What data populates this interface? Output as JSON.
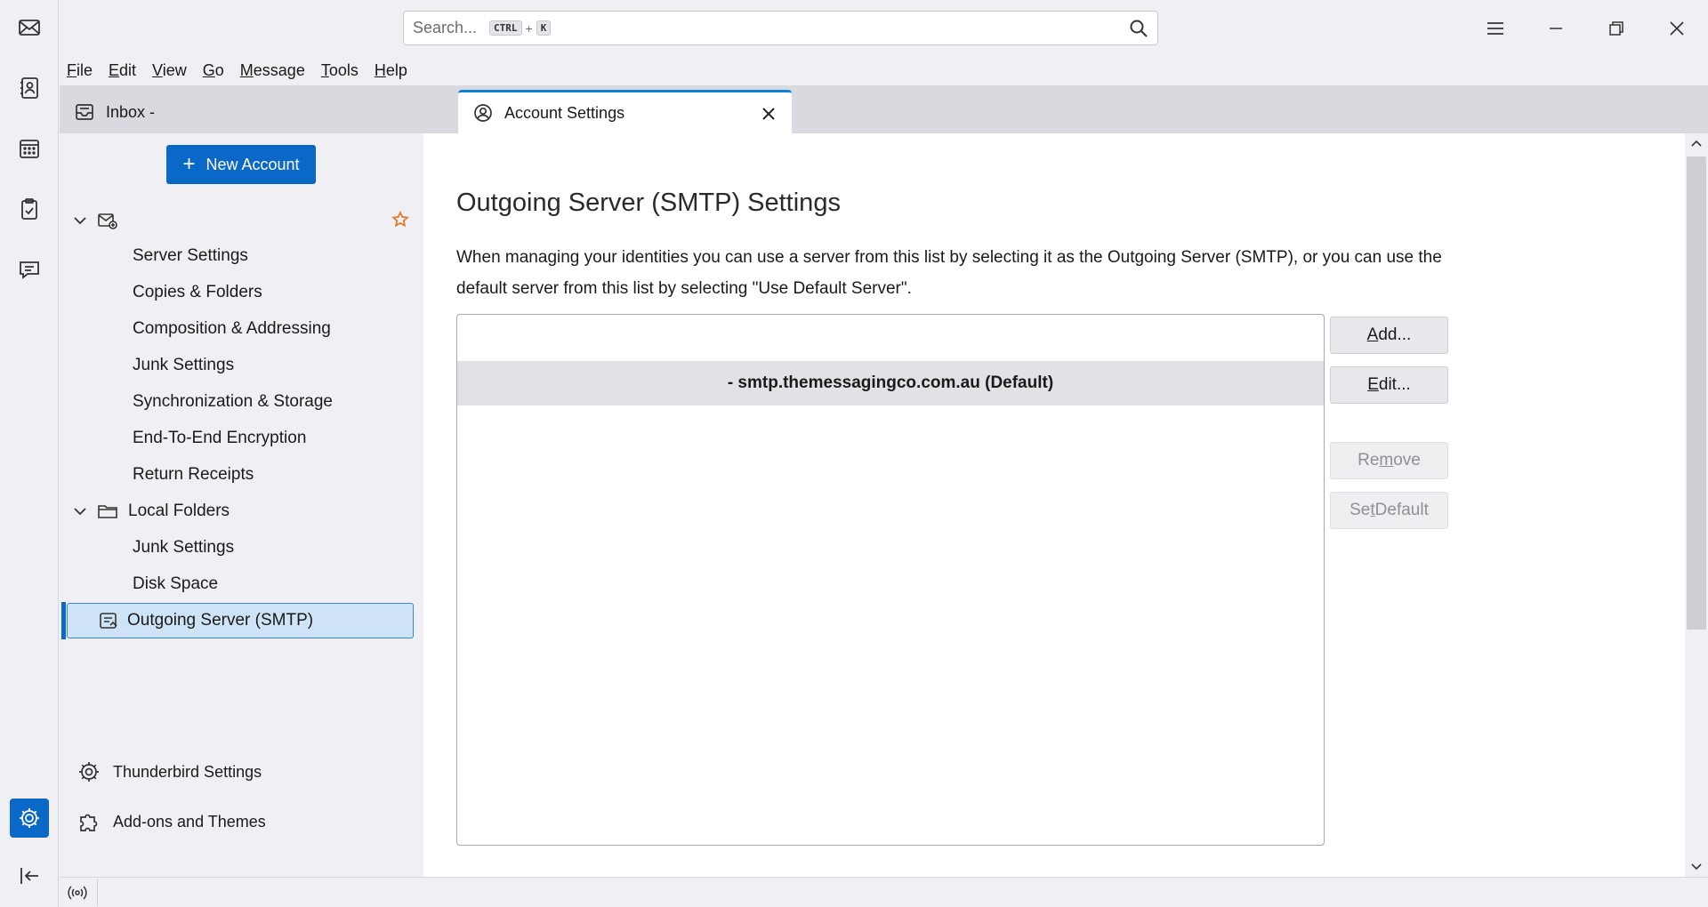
{
  "search": {
    "placeholder": "Search...",
    "key1": "CTRL",
    "plus": "+",
    "key2": "K"
  },
  "menu": [
    {
      "label": "File",
      "ul": "F",
      "rest": "ile"
    },
    {
      "label": "Edit",
      "ul": "E",
      "rest": "dit"
    },
    {
      "label": "View",
      "ul": "V",
      "rest": "iew"
    },
    {
      "label": "Go",
      "ul": "G",
      "rest": "o"
    },
    {
      "label": "Message",
      "ul": "M",
      "rest": "essage"
    },
    {
      "label": "Tools",
      "ul": "T",
      "rest": "ools"
    },
    {
      "label": "Help",
      "ul": "H",
      "rest": "elp"
    }
  ],
  "tabs": {
    "inbox": "Inbox -",
    "settings": "Account Settings"
  },
  "sidebar": {
    "new_account": "New Account",
    "account1_items": [
      "Server Settings",
      "Copies & Folders",
      "Composition & Addressing",
      "Junk Settings",
      "Synchronization & Storage",
      "End-To-End Encryption",
      "Return Receipts"
    ],
    "local_folders": "Local Folders",
    "local_items": [
      "Junk Settings",
      "Disk Space"
    ],
    "outgoing": "Outgoing Server (SMTP)",
    "thunderbird_settings": "Thunderbird Settings",
    "addons": "Add-ons and Themes"
  },
  "main": {
    "title": "Outgoing Server (SMTP) Settings",
    "description": "When managing your identities you can use a server from this list by selecting it as the Outgoing Server (SMTP), or you can use the default server from this list by selecting \"Use Default Server\".",
    "servers": [
      "- smtp.themessagingco.com.au (Default)"
    ],
    "buttons": {
      "add": {
        "pre": "",
        "ul": "A",
        "post": "dd..."
      },
      "edit": {
        "pre": "",
        "ul": "E",
        "post": "dit..."
      },
      "remove": {
        "pre": "Re",
        "ul": "m",
        "post": "ove"
      },
      "set_default": {
        "pre": "Se",
        "ul": "t",
        "post": " Default"
      }
    }
  },
  "colors": {
    "accent": "#0a68c9",
    "selected_bg": "#cfe3f7",
    "default_star": "#e8772e"
  }
}
